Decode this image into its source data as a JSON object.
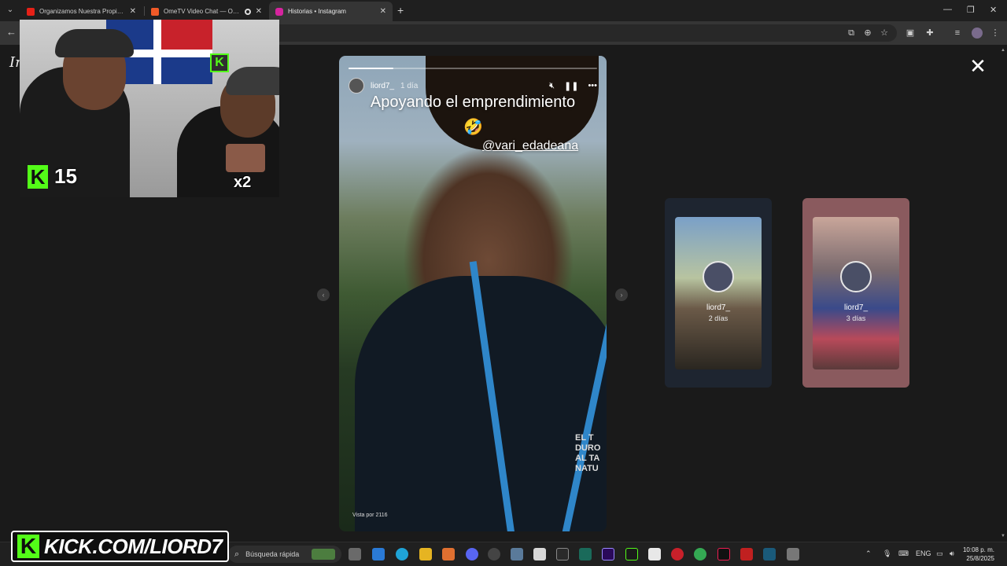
{
  "browser": {
    "tabs": [
      {
        "title": "Organizamos Nuestra Propia V...",
        "favicon_color": "#e62117",
        "active": false
      },
      {
        "title": "OmeTV Video Chat — Ome",
        "favicon_color": "#f05a28",
        "active": false
      },
      {
        "title": "Historias • Instagram",
        "favicon_color": "#d6249f",
        "active": true
      }
    ],
    "new_tab_icon": "plus-icon"
  },
  "instagram": {
    "logo_fragment": "In",
    "story": {
      "user": "liord7_",
      "time": "1 día",
      "caption": "Apoyando el emprendimiento",
      "emoji": "🤣",
      "mention": "@vari_edadeana",
      "views": "Vista por 2116",
      "progress": 0.18,
      "shirt_text": "EL T\nDURO\nAL TA\nNATU"
    },
    "previews": [
      {
        "user": "liord7_",
        "time": "2 días",
        "bg_color": "#1e2530",
        "thumb_color": "#3b4660"
      },
      {
        "user": "liord7_",
        "time": "3 días",
        "bg_color": "#8a5a5e",
        "thumb_color": "#5a3a45"
      }
    ]
  },
  "stream_overlay": {
    "kick_count": "15",
    "multiplier": "x2",
    "kick_badge": "K",
    "banner_k": "K",
    "banner_url": "KICK.COM/LIORD7"
  },
  "taskbar": {
    "search_placeholder": "Búsqueda rápida",
    "language": "ENG",
    "time": "10:08 p. m.",
    "date": "25/8/2025",
    "accent": "#3fa0f0"
  }
}
